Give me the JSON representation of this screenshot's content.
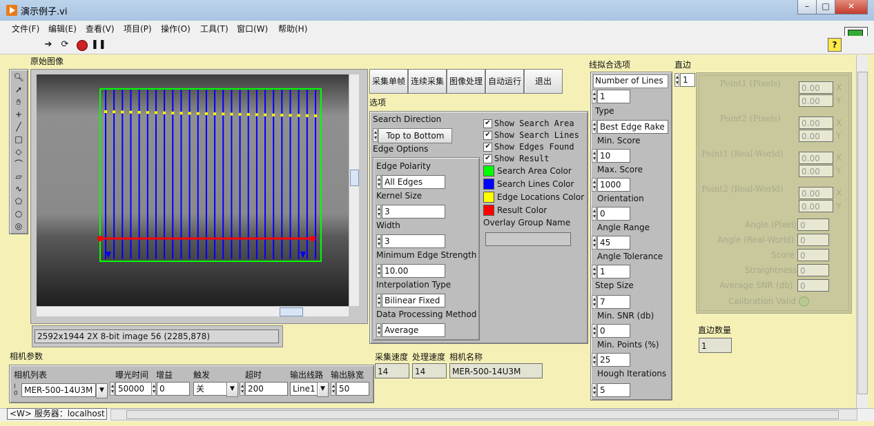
{
  "window": {
    "title": "演示例子.vi",
    "min": "–",
    "max": "□",
    "close": "✕"
  },
  "menu": [
    "文件(F)",
    "编辑(E)",
    "查看(V)",
    "项目(P)",
    "操作(O)",
    "工具(T)",
    "窗口(W)",
    "帮助(H)"
  ],
  "image_panel": {
    "label": "原始图像",
    "info": "2592x1944 2X 8-bit image 56    (2285,878)"
  },
  "buttons": {
    "single": "采集单帧",
    "continuous": "连续采集",
    "process": "图像处理",
    "auto": "自动运行",
    "exit": "退出"
  },
  "options": {
    "label": "选项",
    "search_direction_label": "Search Direction",
    "search_direction": "Top to Bottom",
    "edge_options_label": "Edge Options",
    "edge_polarity_label": "Edge Polarity",
    "edge_polarity": "All Edges",
    "kernel_size_label": "Kernel Size",
    "kernel_size": "3",
    "width_label": "Width",
    "width": "3",
    "min_edge_strength_label": "Minimum Edge Strength",
    "min_edge_strength": "10.00",
    "interpolation_label": "Interpolation Type",
    "interpolation": "Bilinear Fixed",
    "data_processing_label": "Data Processing Method",
    "data_processing": "Average",
    "show_search_area": "Show Search Area",
    "show_search_lines": "Show Search Lines",
    "show_edges_found": "Show Edges Found",
    "show_result": "Show Result",
    "search_area_color": "Search Area Color",
    "search_lines_color": "Search Lines Color",
    "edge_locations_color": "Edge Locations Color",
    "result_color": "Result Color",
    "overlay_group_label": "Overlay Group Name",
    "colors": {
      "area": "#00ff00",
      "lines": "#0000ff",
      "edges": "#ffff00",
      "result": "#ff0000"
    }
  },
  "line_fit": {
    "label": "线拟合选项",
    "num_lines_label": "Number of Lines",
    "num_lines": "1",
    "type_label": "Type",
    "type": "Best Edge Rake",
    "min_score_label": "Min. Score",
    "min_score": "10",
    "max_score_label": "Max. Score",
    "max_score": "1000",
    "orientation_label": "Orientation",
    "orientation": "0",
    "angle_range_label": "Angle Range",
    "angle_range": "45",
    "angle_tol_label": "Angle Tolerance",
    "angle_tol": "1",
    "step_size_label": "Step Size",
    "step_size": "7",
    "min_snr_label": "Min. SNR (db)",
    "min_snr": "0",
    "min_points_label": "Min. Points (%)",
    "min_points": "25",
    "hough_label": "Hough Iterations",
    "hough": "5"
  },
  "straight_edge": {
    "label": "直边",
    "index": "1",
    "p1_pix": "Point1 (Pixels)",
    "p2_pix": "Point2 (Pixels)",
    "p1_rw": "Point1 (Real-World)",
    "p2_rw": "Point2 (Real-World)",
    "zero": "0.00",
    "x": "X",
    "y": "Y",
    "angle_pix": "Angle (Pixel)",
    "angle_rw": "Angle (Real-World)",
    "score": "Score",
    "straightness": "Straightness",
    "avg_snr": "Average SNR (db)",
    "calib": "Calibration Valid",
    "val": "0",
    "count_label": "直边数量",
    "count": "1"
  },
  "camera": {
    "section": "相机参数",
    "list_label": "相机列表",
    "exposure_label": "曝光时间",
    "gain_label": "增益",
    "trigger_label": "触发",
    "timeout_label": "超时",
    "out_line_label": "输出线路",
    "out_pulse_label": "输出脉宽",
    "cam": "MER-500-14U3M",
    "exposure": "50000",
    "gain": "0",
    "trigger": "关",
    "timeout": "200",
    "out_line": "Line1",
    "out_pulse": "50"
  },
  "speed": {
    "acq_label": "采集速度",
    "proc_label": "处理速度",
    "name_label": "相机名称",
    "acq": "14",
    "proc": "14",
    "name": "MER-500-14U3M"
  },
  "status": {
    "server": "<W> 服务器：localhost"
  }
}
